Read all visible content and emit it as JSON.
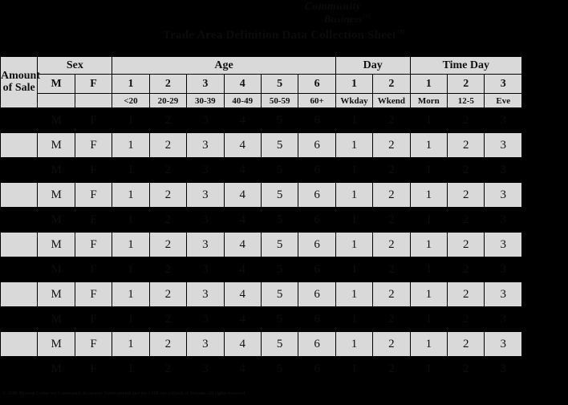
{
  "page": {
    "background_color": "#000000",
    "table_cell_color": "#d9d9d9",
    "text_color": "#111111"
  },
  "header": {
    "brand_line1": "Community",
    "brand_line2": "Business",
    "brand_tm": "TM",
    "title": "Trade Area Definition Data Collection Sheet",
    "title_sup": "TM"
  },
  "table": {
    "groups": [
      {
        "label": "Amount of Sale",
        "span": 1
      },
      {
        "label": "Sex",
        "span": 2
      },
      {
        "label": "Age",
        "span": 6
      },
      {
        "label": "Day",
        "span": 2
      },
      {
        "label": "Time Day",
        "span": 3
      }
    ],
    "amount_line1": "Amount",
    "amount_line2": "of Sale",
    "codes": {
      "sex": [
        "M",
        "F"
      ],
      "age": [
        "1",
        "2",
        "3",
        "4",
        "5",
        "6"
      ],
      "day": [
        "1",
        "2"
      ],
      "time": [
        "1",
        "2",
        "3"
      ]
    },
    "labels": {
      "age": [
        "<20",
        "20-29",
        "30-39",
        "40-49",
        "50-59",
        "60+"
      ],
      "day": [
        "Wkday",
        "Wkend"
      ],
      "time": [
        "Morn",
        "12-5",
        "Eve"
      ]
    },
    "row_values": {
      "amount": "",
      "sex": [
        "M",
        "F"
      ],
      "age": [
        "1",
        "2",
        "3",
        "4",
        "5",
        "6"
      ],
      "day": [
        "1",
        "2"
      ],
      "time": [
        "1",
        "2",
        "3"
      ]
    },
    "row_count": 11
  },
  "footer": {
    "copyright": "© 2000 Mission Center for Community Economic Development and the UNR site utilized of Nevada. All rights reserved."
  }
}
